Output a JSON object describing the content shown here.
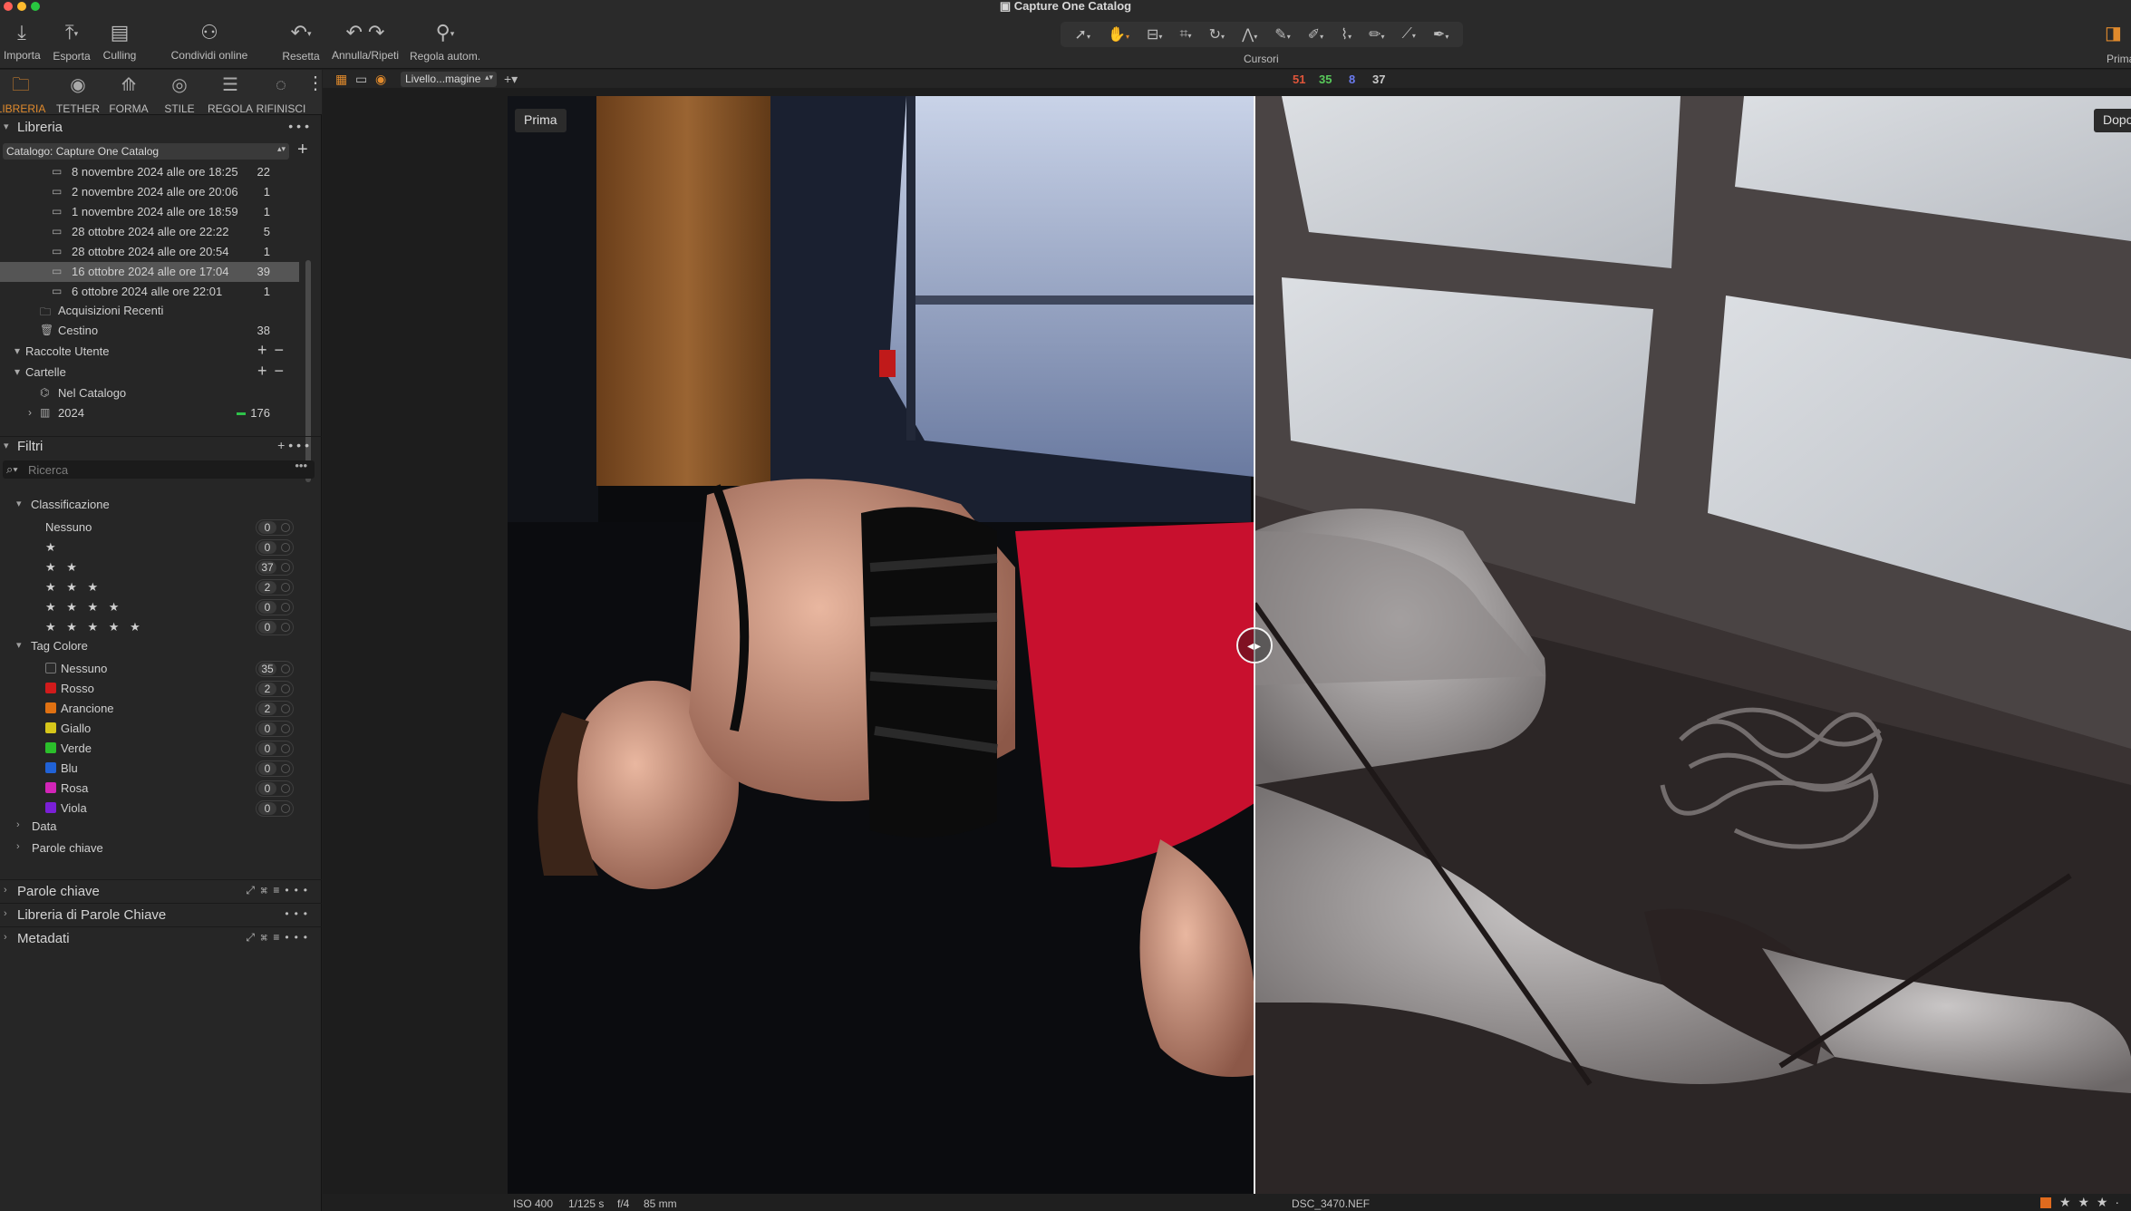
{
  "window": {
    "title": "Capture One Catalog"
  },
  "toolbar": {
    "import_label": "Importa",
    "export_label": "Esporta",
    "culling_label": "Culling",
    "share_label": "Condividi online",
    "reset_label": "Resetta",
    "undo_redo_label": "Annulla/Ripeti",
    "auto_adjust_label": "Regola autom.",
    "cursors_label": "Cursori",
    "before_after_label": "Prima"
  },
  "tool_tabs": [
    {
      "label": "LIBRERIA",
      "icon": "folder-icon",
      "active": true
    },
    {
      "label": "TETHER",
      "icon": "camera-icon",
      "active": false
    },
    {
      "label": "FORMA",
      "icon": "shape-icon",
      "active": false
    },
    {
      "label": "STILE",
      "icon": "style-icon",
      "active": false
    },
    {
      "label": "REGOLA",
      "icon": "sliders-icon",
      "active": false
    },
    {
      "label": "RIFINISCI",
      "icon": "refine-icon",
      "active": false
    }
  ],
  "library": {
    "title": "Libreria",
    "catalog_select": "Catalogo: Capture One Catalog",
    "imports": [
      {
        "label": "8 novembre 2024 alle ore 18:25",
        "count": "22"
      },
      {
        "label": "2 novembre 2024 alle ore 20:06",
        "count": "1"
      },
      {
        "label": "1 novembre 2024 alle ore 18:59",
        "count": "1"
      },
      {
        "label": "28 ottobre 2024 alle ore 22:22",
        "count": "5"
      },
      {
        "label": "28 ottobre 2024 alle ore 20:54",
        "count": "1"
      },
      {
        "label": "16 ottobre 2024 alle ore 17:04",
        "count": "39"
      },
      {
        "label": "6 ottobre 2024 alle ore 22:01",
        "count": "1"
      }
    ],
    "recent": "Acquisizioni Recenti",
    "trash": {
      "label": "Cestino",
      "count": "38"
    },
    "user_collections": "Raccolte Utente",
    "folders": "Cartelle",
    "in_catalog": "Nel Catalogo",
    "year_folder": {
      "label": "2024",
      "count": "176"
    }
  },
  "filters": {
    "title": "Filtri",
    "search_placeholder": "Ricerca",
    "rating_title": "Classificazione",
    "ratings": [
      {
        "label": "Nessuno",
        "count": "0"
      },
      {
        "label": "★",
        "count": "0"
      },
      {
        "label": "★ ★",
        "count": "37"
      },
      {
        "label": "★ ★ ★",
        "count": "2"
      },
      {
        "label": "★ ★ ★ ★",
        "count": "0"
      },
      {
        "label": "★ ★ ★ ★ ★",
        "count": "0"
      }
    ],
    "color_title": "Tag Colore",
    "colors": [
      {
        "label": "Nessuno",
        "count": "35",
        "color": "#2a2a2a"
      },
      {
        "label": "Rosso",
        "count": "2",
        "color": "#d11b1b"
      },
      {
        "label": "Arancione",
        "count": "2",
        "color": "#e07112"
      },
      {
        "label": "Giallo",
        "count": "0",
        "color": "#d6c61a"
      },
      {
        "label": "Verde",
        "count": "0",
        "color": "#2bbf2b"
      },
      {
        "label": "Blu",
        "count": "0",
        "color": "#2062d6"
      },
      {
        "label": "Rosa",
        "count": "0",
        "color": "#d225b8"
      },
      {
        "label": "Viola",
        "count": "0",
        "color": "#7a1fd6"
      }
    ],
    "date_label": "Data",
    "keywords_label": "Parole chiave"
  },
  "bottom_panels": {
    "keywords": "Parole chiave",
    "keyword_library": "Libreria di Parole Chiave",
    "metadata": "Metadati"
  },
  "viewer": {
    "variant_select": "Livello...magine",
    "counts": {
      "red": "51",
      "green": "35",
      "blue": "8",
      "lum": "37"
    },
    "before_label": "Prima",
    "after_label": "Dopo"
  },
  "status": {
    "iso": "ISO 400",
    "shutter": "1/125 s",
    "aperture": "f/4",
    "focal": "85 mm",
    "filename": "DSC_3470.NEF",
    "rating": "★ ★ ★ ·"
  },
  "colors": {
    "accent": "#e08a2c",
    "panel": "#262626",
    "toolbar": "#2a2a2a"
  }
}
